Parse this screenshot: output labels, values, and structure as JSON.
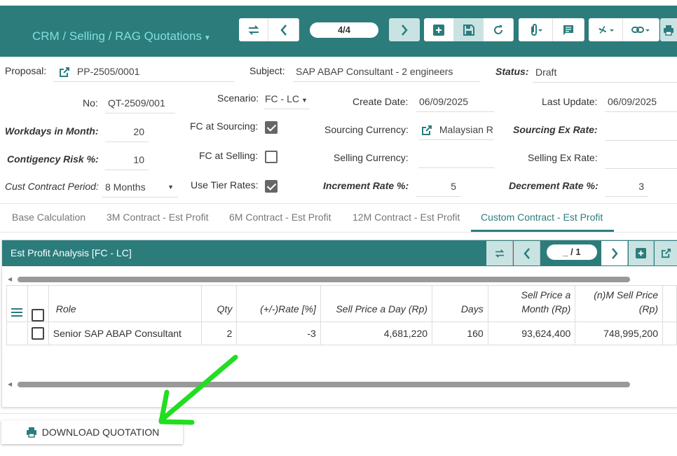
{
  "header": {
    "breadcrumb": "CRM / Selling / RAG Quotations",
    "pager": "4/4"
  },
  "form": {
    "proposal_label": "Proposal:",
    "proposal_value": "PP-2505/0001",
    "subject_label": "Subject:",
    "subject_value": "SAP ABAP Consultant - 2 engineers",
    "status_label": "Status:",
    "status_value": "Draft",
    "no_label": "No:",
    "no_value": "QT-2509/001",
    "scenario_label": "Scenario:",
    "scenario_value": "FC - LC",
    "create_date_label": "Create Date:",
    "create_date_value": "06/09/2025",
    "last_update_label": "Last Update:",
    "last_update_value": "06/09/2025",
    "workdays_label": "Workdays in Month:",
    "workdays_value": "20",
    "fc_sourcing_label": "FC at Sourcing:",
    "fc_sourcing_checked": true,
    "sourcing_currency_label": "Sourcing Currency:",
    "sourcing_currency_value": "Malaysian R",
    "sourcing_ex_rate_label": "Sourcing Ex Rate:",
    "contingency_label": "Contigency Risk %:",
    "contingency_value": "10",
    "fc_selling_label": "FC at Selling:",
    "fc_selling_checked": false,
    "selling_currency_label": "Selling Currency:",
    "selling_ex_rate_label": "Selling Ex Rate:",
    "contract_period_label": "Cust Contract Period:",
    "contract_period_value": "8 Months",
    "tier_rates_label": "Use Tier Rates:",
    "tier_rates_checked": true,
    "increment_label": "Increment Rate %:",
    "increment_value": "5",
    "decrement_label": "Decrement Rate %:",
    "decrement_value": "3"
  },
  "tabs": [
    {
      "label": "Base Calculation"
    },
    {
      "label": "3M Contract - Est Profit"
    },
    {
      "label": "6M Contract - Est Profit"
    },
    {
      "label": "12M Contract - Est Profit"
    },
    {
      "label": "Custom Contract - Est Profit"
    }
  ],
  "panel": {
    "title": "Est Profit Analysis [FC - LC]",
    "pager": "_ / 1"
  },
  "table": {
    "headers": [
      "Role",
      "Qty",
      "(+/-)Rate [%]",
      "Sell Price a Day (Rp)",
      "Days",
      "Sell Price a Month (Rp)",
      "(n)M Sell Price (Rp)"
    ],
    "rows": [
      [
        "Senior SAP ABAP Consultant",
        "2",
        "-3",
        "4,681,220",
        "160",
        "93,624,400",
        "748,995,200"
      ]
    ]
  },
  "download_button": "DOWNLOAD QUOTATION",
  "colors": {
    "primary": "#2c7c7c",
    "accent_light": "#7fe0de",
    "annotation_arrow": "#22dd22"
  }
}
